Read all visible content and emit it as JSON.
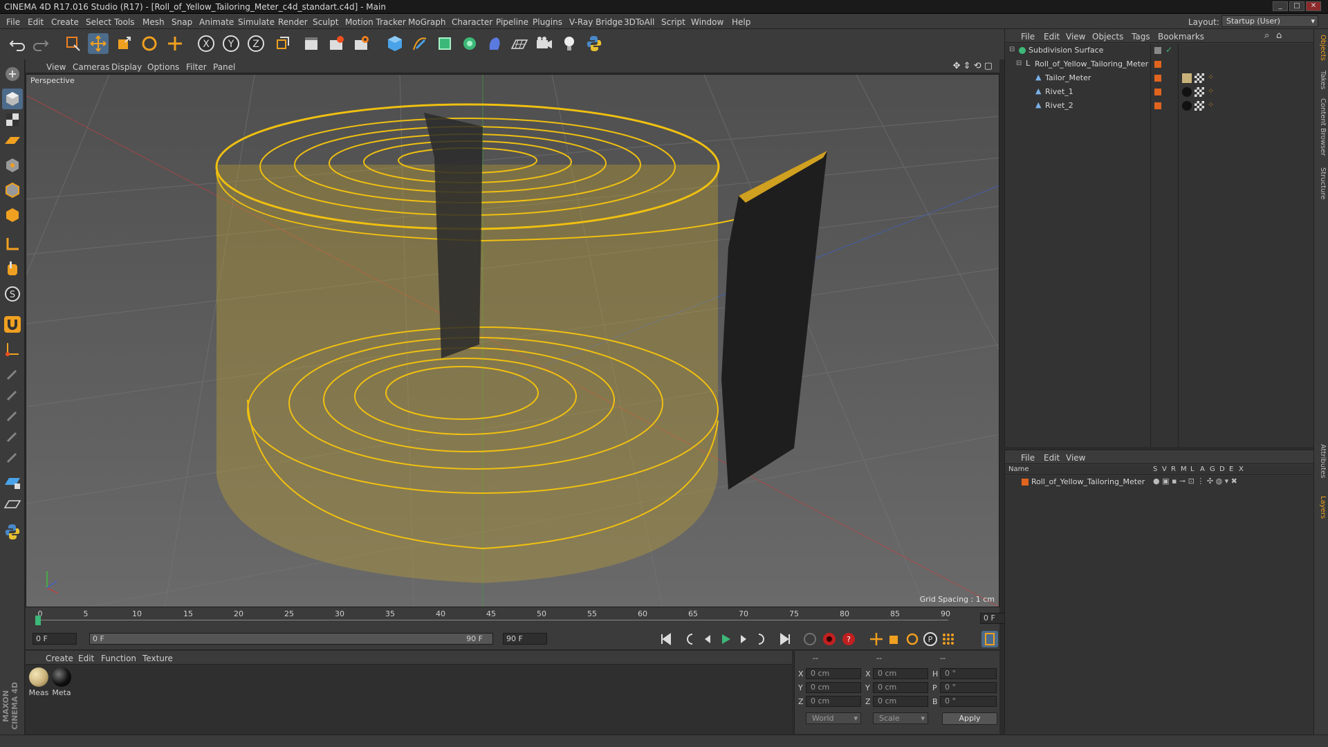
{
  "window": {
    "title": "CINEMA 4D R17.016 Studio (R17) - [Roll_of_Yellow_Tailoring_Meter_c4d_standart.c4d] - Main"
  },
  "menubar": {
    "items": [
      "File",
      "Edit",
      "Create",
      "Select",
      "Tools",
      "Mesh",
      "Snap",
      "Animate",
      "Simulate",
      "Render",
      "Sculpt",
      "Motion Tracker",
      "MoGraph",
      "Character",
      "Pipeline",
      "Plugins",
      "V-Ray Bridge",
      "3DToAll",
      "Script",
      "Window",
      "Help"
    ],
    "layout_label": "Layout:",
    "layout_value": "Startup (User)"
  },
  "viewport": {
    "menu": [
      "View",
      "Cameras",
      "Display",
      "Options",
      "Filter",
      "Panel"
    ],
    "camera_label": "Perspective",
    "grid_spacing": "Grid Spacing : 1 cm"
  },
  "timeline": {
    "ticks": [
      "0",
      "5",
      "10",
      "15",
      "20",
      "25",
      "30",
      "35",
      "40",
      "45",
      "50",
      "55",
      "60",
      "65",
      "70",
      "75",
      "80",
      "85",
      "90"
    ],
    "current_frame": "0 F"
  },
  "transport": {
    "start_field": "0 F",
    "range_start": "0 F",
    "range_end": "90 F",
    "end_field": "90 F"
  },
  "materials": {
    "menu": [
      "Create",
      "Edit",
      "Function",
      "Texture"
    ],
    "items": [
      {
        "name": "Meas",
        "color": "#c9b27a"
      },
      {
        "name": "Meta",
        "color": "#111111"
      }
    ]
  },
  "coordinates": {
    "header": [
      "--",
      "--",
      "--"
    ],
    "rows": [
      {
        "label": "X",
        "pos": "0 cm",
        "label2": "X",
        "size": "0 cm",
        "label3": "H",
        "rot": "0 °"
      },
      {
        "label": "Y",
        "pos": "0 cm",
        "label2": "Y",
        "size": "0 cm",
        "label3": "P",
        "rot": "0 °"
      },
      {
        "label": "Z",
        "pos": "0 cm",
        "label2": "Z",
        "size": "0 cm",
        "label3": "B",
        "rot": "0 °"
      }
    ],
    "space_select": "World",
    "mode_select": "Scale",
    "apply_label": "Apply"
  },
  "object_manager": {
    "menu": [
      "File",
      "Edit",
      "View",
      "Objects",
      "Tags",
      "Bookmarks"
    ],
    "objects": [
      {
        "name": "Subdivision Surface"
      },
      {
        "name": "Roll_of_Yellow_Tailoring_Meter"
      },
      {
        "name": "Tailor_Meter"
      },
      {
        "name": "Rivet_1"
      },
      {
        "name": "Rivet_2"
      }
    ]
  },
  "layer_manager": {
    "menu": [
      "File",
      "Edit",
      "View"
    ],
    "columns": [
      "Name",
      "S",
      "V",
      "R",
      "M",
      "L",
      "A",
      "G",
      "D",
      "E",
      "X"
    ],
    "layers": [
      {
        "name": "Roll_of_Yellow_Tailoring_Meter",
        "color": "#e0641e"
      }
    ]
  },
  "right_tabs": [
    "Objects",
    "Takes",
    "Content Browser",
    "Structure",
    "Attributes",
    "Layers"
  ],
  "colors": {
    "accent": "#4aa3e8",
    "yellow": "#f0c010",
    "orange": "#e0641e"
  }
}
